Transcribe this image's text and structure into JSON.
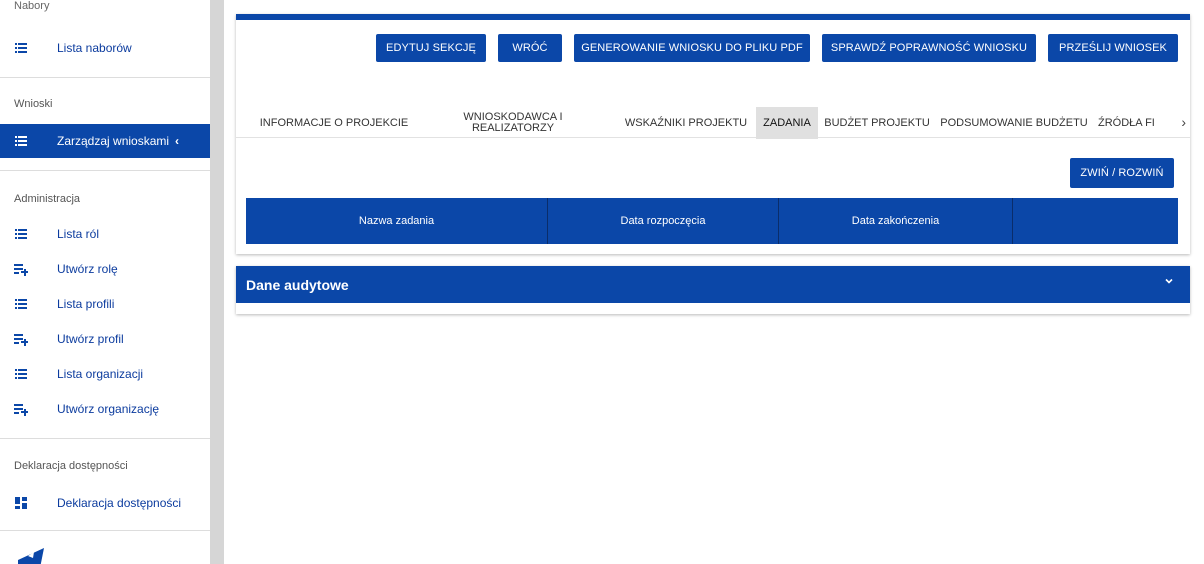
{
  "sidebar": {
    "top_cut_label": "Nabory",
    "nabory_item": "Lista naborów",
    "wnioski_header": "Wnioski",
    "wnioski_item": "Zarządzaj wnioskami",
    "admin_header": "Administracja",
    "admin_items": [
      {
        "label": "Lista ról",
        "icon": "list-icon"
      },
      {
        "label": "Utwórz rolę",
        "icon": "playlist-add-icon"
      },
      {
        "label": "Lista profili",
        "icon": "list-icon"
      },
      {
        "label": "Utwórz profil",
        "icon": "playlist-add-icon"
      },
      {
        "label": "Lista organizacji",
        "icon": "list-icon"
      },
      {
        "label": "Utwórz organizację",
        "icon": "playlist-add-icon"
      }
    ],
    "access_header": "Deklaracja dostępności",
    "access_item": "Deklaracja dostępności"
  },
  "toolbar": {
    "edit": "EDYTUJ SEKCJĘ",
    "back": "WRÓĆ",
    "pdf": "GENEROWANIE WNIOSKU DO PLIKU PDF",
    "validate": "SPRAWDŹ POPRAWNOŚĆ WNIOSKU",
    "send": "PRZEŚLIJ WNIOSEK"
  },
  "tabs": {
    "info": "INFORMACJE O PROJEKCIE",
    "applicant_1": "WNIOSKODAWCA I",
    "applicant_2": "REALIZATORZY",
    "indicators": "WSKAŹNIKI PROJEKTU",
    "tasks": "ZADANIA",
    "budget": "BUDŻET PROJEKTU",
    "budget_summary": "PODSUMOWANIE BUDŻETU",
    "sources": "ŹRÓDŁA FI"
  },
  "collapse_button": "ZWIŃ / ROZWIŃ",
  "table": {
    "col_name": "Nazwa zadania",
    "col_start": "Data rozpoczęcia",
    "col_end": "Data zakończenia",
    "col_actions": ""
  },
  "audit": {
    "title": "Dane audytowe"
  },
  "colors": {
    "primary": "#0b47a8"
  }
}
